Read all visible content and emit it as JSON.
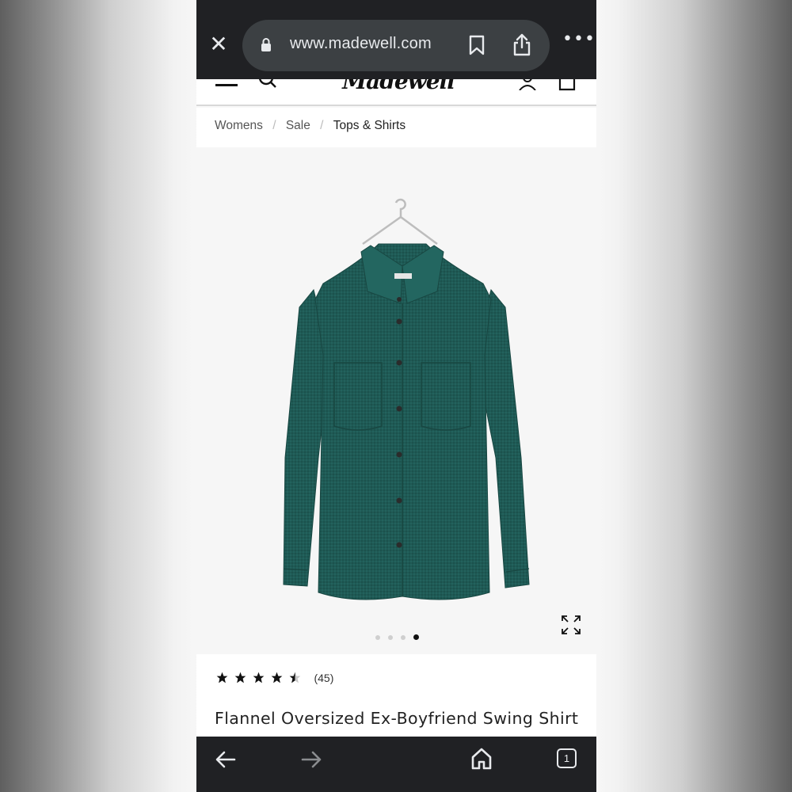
{
  "browser": {
    "url": "www.madewell.com",
    "tab_count": "1"
  },
  "site": {
    "logo_text": "Madewell"
  },
  "breadcrumb": {
    "items": [
      "Womens",
      "Sale",
      "Tops & Shirts"
    ]
  },
  "product": {
    "rating": 4.5,
    "review_count": "(45)",
    "title": "Flannel Oversized Ex-Boyfriend Swing Shirt",
    "image_count": 4,
    "active_image_index": 3,
    "color_hex": "#1f5a55"
  },
  "icons": {
    "close": "close-icon",
    "lock": "lock-icon",
    "bookmark": "bookmark-icon",
    "share": "share-icon",
    "more": "more-icon",
    "menu": "menu-icon",
    "search": "search-icon",
    "account": "account-icon",
    "bag": "bag-icon",
    "expand": "expand-icon",
    "back": "back-arrow-icon",
    "forward": "forward-arrow-icon",
    "home": "home-icon",
    "tabs": "tabs-icon"
  },
  "colors": {
    "browser_bar": "#202124",
    "urlbar": "#3c4043",
    "shirt": "#1f5a55"
  }
}
